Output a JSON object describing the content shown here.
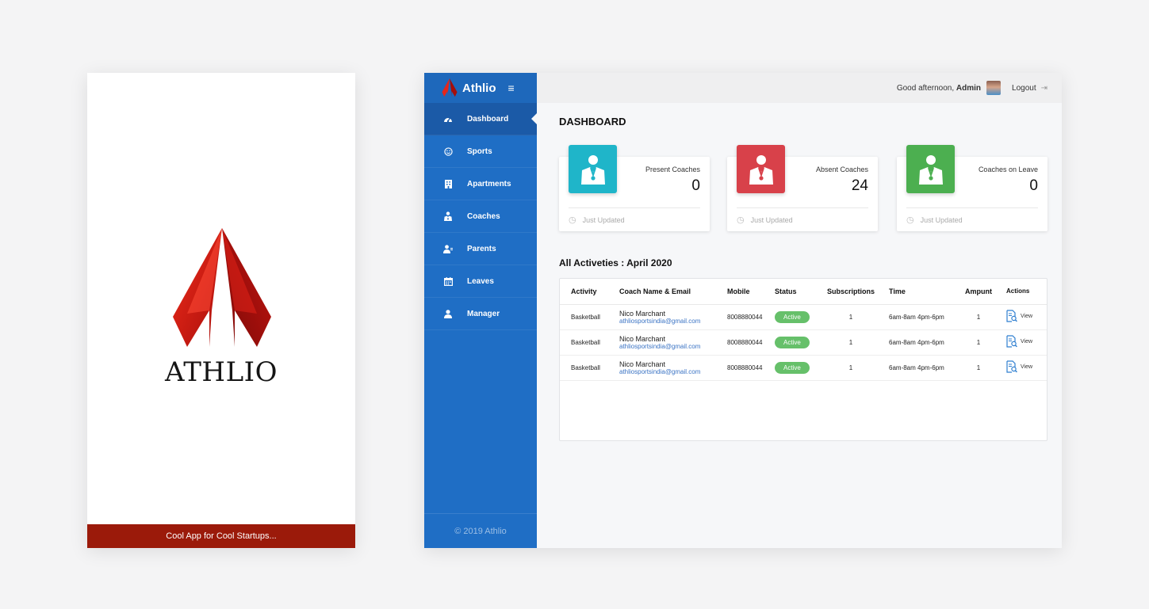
{
  "splash": {
    "wordmark": "ATHLIO",
    "tagline": "Cool App for Cool Startups..."
  },
  "app": {
    "brand": "Athlio",
    "hamburger_icon": "≡",
    "sidebar": {
      "items": [
        {
          "label": "Dashboard",
          "icon": "dashboard-icon",
          "active": true
        },
        {
          "label": "Sports",
          "icon": "smiley-icon",
          "active": false
        },
        {
          "label": "Apartments",
          "icon": "building-icon",
          "active": false
        },
        {
          "label": "Coaches",
          "icon": "coach-icon",
          "active": false
        },
        {
          "label": "Parents",
          "icon": "parent-icon",
          "active": false
        },
        {
          "label": "Leaves",
          "icon": "calendar-icon",
          "active": false
        },
        {
          "label": "Manager",
          "icon": "user-icon",
          "active": false
        }
      ],
      "footer": "© 2019 Athlio"
    },
    "topbar": {
      "greeting_prefix": "Good afternoon, ",
      "user": "Admin",
      "logout": "Logout"
    },
    "page_title": "DASHBOARD",
    "stats": [
      {
        "label": "Present Coaches",
        "value": "0",
        "footer": "Just Updated",
        "color": "#1fb5c9"
      },
      {
        "label": "Absent Coaches",
        "value": "24",
        "footer": "Just Updated",
        "color": "#d8414a"
      },
      {
        "label": "Coaches on Leave",
        "value": "0",
        "footer": "Just Updated",
        "color": "#4caf50"
      }
    ],
    "activities": {
      "title": "All Activeties : April 2020",
      "columns": [
        "Activity",
        "Coach Name & Email",
        "Mobile",
        "Status",
        "Subscriptions",
        "Time",
        "Ampunt",
        "Actions"
      ],
      "rows": [
        {
          "activity": "Basketball",
          "name": "Nico Marchant",
          "email": "athliosportsindia@gmail.com",
          "mobile": "8008880044",
          "status": "Active",
          "subscriptions": "1",
          "time": "6am-8am 4pm-6pm",
          "amount": "1",
          "action": "View"
        },
        {
          "activity": "Basketball",
          "name": "Nico Marchant",
          "email": "athliosportsindia@gmail.com",
          "mobile": "8008880044",
          "status": "Active",
          "subscriptions": "1",
          "time": "6am-8am 4pm-6pm",
          "amount": "1",
          "action": "View"
        },
        {
          "activity": "Basketball",
          "name": "Nico Marchant",
          "email": "athliosportsindia@gmail.com",
          "mobile": "8008880044",
          "status": "Active",
          "subscriptions": "1",
          "time": "6am-8am 4pm-6pm",
          "amount": "1",
          "action": "View"
        }
      ]
    }
  }
}
